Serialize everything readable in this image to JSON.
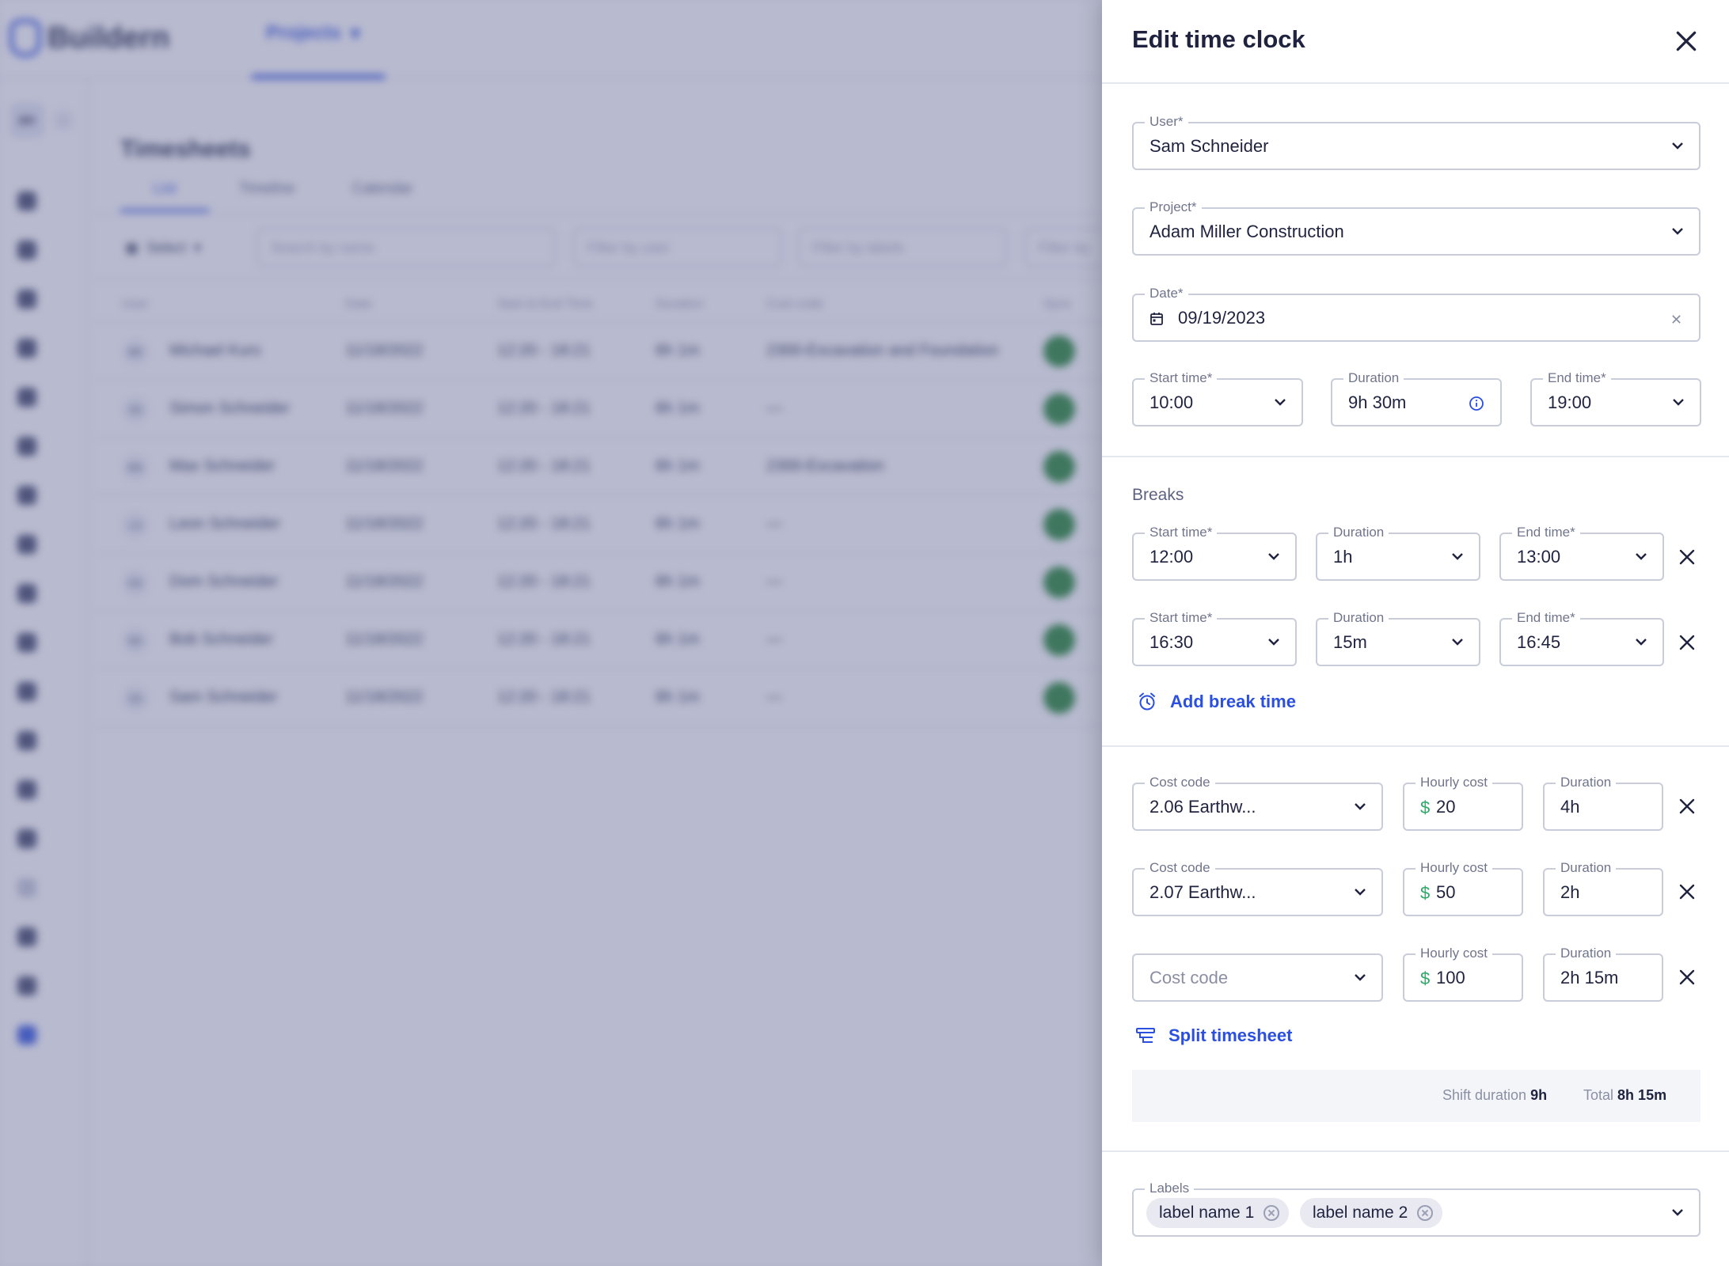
{
  "background": {
    "app_name": "Buildern",
    "nav": {
      "projects_label": "Projects"
    },
    "sidebar": {
      "badge": "BR"
    },
    "page_title": "Timesheets",
    "tabs": [
      "List",
      "Timeline",
      "Calendar"
    ],
    "filters": {
      "select_label": "Select",
      "search_placeholder": "Search by name",
      "filter_user": "Filter by user",
      "filter_labels": "Filter by labels",
      "filter_more": "Filter by"
    },
    "table": {
      "headers": [
        "User",
        "Date",
        "Start & End Time",
        "Duration",
        "Cost code",
        "Sync"
      ],
      "rows": [
        {
          "initials": "MK",
          "name": "Michael Kurs",
          "date": "11/18/2022",
          "time": "12:20 - 18:21",
          "duration": "6h 1m",
          "cost_code": "2300-Excavation and Foundation"
        },
        {
          "initials": "SS",
          "name": "Simon Schneider",
          "date": "11/18/2022",
          "time": "12:20 - 18:21",
          "duration": "6h 1m",
          "cost_code": "—"
        },
        {
          "initials": "MS",
          "name": "Max Schneider",
          "date": "11/18/2022",
          "time": "12:20 - 18:21",
          "duration": "6h 1m",
          "cost_code": "2300-Excavation"
        },
        {
          "initials": "LS",
          "name": "Leon Schneider",
          "date": "11/18/2022",
          "time": "12:20 - 18:21",
          "duration": "6h 1m",
          "cost_code": "—"
        },
        {
          "initials": "DS",
          "name": "Dom Schneider",
          "date": "11/18/2022",
          "time": "12:20 - 18:21",
          "duration": "6h 1m",
          "cost_code": "—"
        },
        {
          "initials": "BS",
          "name": "Bob Schneider",
          "date": "11/18/2022",
          "time": "12:20 - 18:21",
          "duration": "6h 1m",
          "cost_code": "—"
        },
        {
          "initials": "SS",
          "name": "Sam Schneider",
          "date": "11/18/2022",
          "time": "12:20 - 18:21",
          "duration": "6h 1m",
          "cost_code": "—"
        }
      ]
    }
  },
  "drawer": {
    "title": "Edit time clock",
    "user": {
      "label": "User*",
      "value": "Sam Schneider"
    },
    "project": {
      "label": "Project*",
      "value": "Adam Miller Construction"
    },
    "date": {
      "label": "Date*",
      "value": "09/19/2023"
    },
    "shift": {
      "start": {
        "label": "Start time*",
        "value": "10:00"
      },
      "duration": {
        "label": "Duration",
        "value": "9h 30m"
      },
      "end": {
        "label": "End time*",
        "value": "19:00"
      }
    },
    "breaks": {
      "title": "Breaks",
      "items": [
        {
          "start_label": "Start time*",
          "start": "12:00",
          "duration_label": "Duration",
          "duration": "1h",
          "end_label": "End time*",
          "end": "13:00"
        },
        {
          "start_label": "Start time*",
          "start": "16:30",
          "duration_label": "Duration",
          "duration": "15m",
          "end_label": "End time*",
          "end": "16:45"
        }
      ],
      "add_label": "Add break time"
    },
    "cost_codes": {
      "items": [
        {
          "code_label": "Cost code",
          "code": "2.06 Earthw...",
          "cost_label": "Hourly cost",
          "currency": "$",
          "cost": "20",
          "duration_label": "Duration",
          "duration": "4h"
        },
        {
          "code_label": "Cost code",
          "code": "2.07 Earthw...",
          "cost_label": "Hourly cost",
          "currency": "$",
          "cost": "50",
          "duration_label": "Duration",
          "duration": "2h"
        },
        {
          "code_placeholder": "Cost code",
          "cost_label": "Hourly cost",
          "currency": "$",
          "cost": "100",
          "duration_label": "Duration",
          "duration": "2h 15m"
        }
      ],
      "split_label": "Split timesheet"
    },
    "summary": {
      "shift_label": "Shift duration",
      "shift_value": "9h",
      "total_label": "Total",
      "total_value": "8h 15m"
    },
    "labels": {
      "label": "Labels",
      "chips": [
        "label name 1",
        "label name 2"
      ]
    },
    "colors": {
      "accent": "#2b4fe0",
      "currency": "#2ea866",
      "sync": "#2e8b3d"
    },
    "icons": [
      "close-icon",
      "chevron-down-icon",
      "calendar-icon",
      "info-icon",
      "alarm-clock-icon",
      "split-icon"
    ]
  }
}
